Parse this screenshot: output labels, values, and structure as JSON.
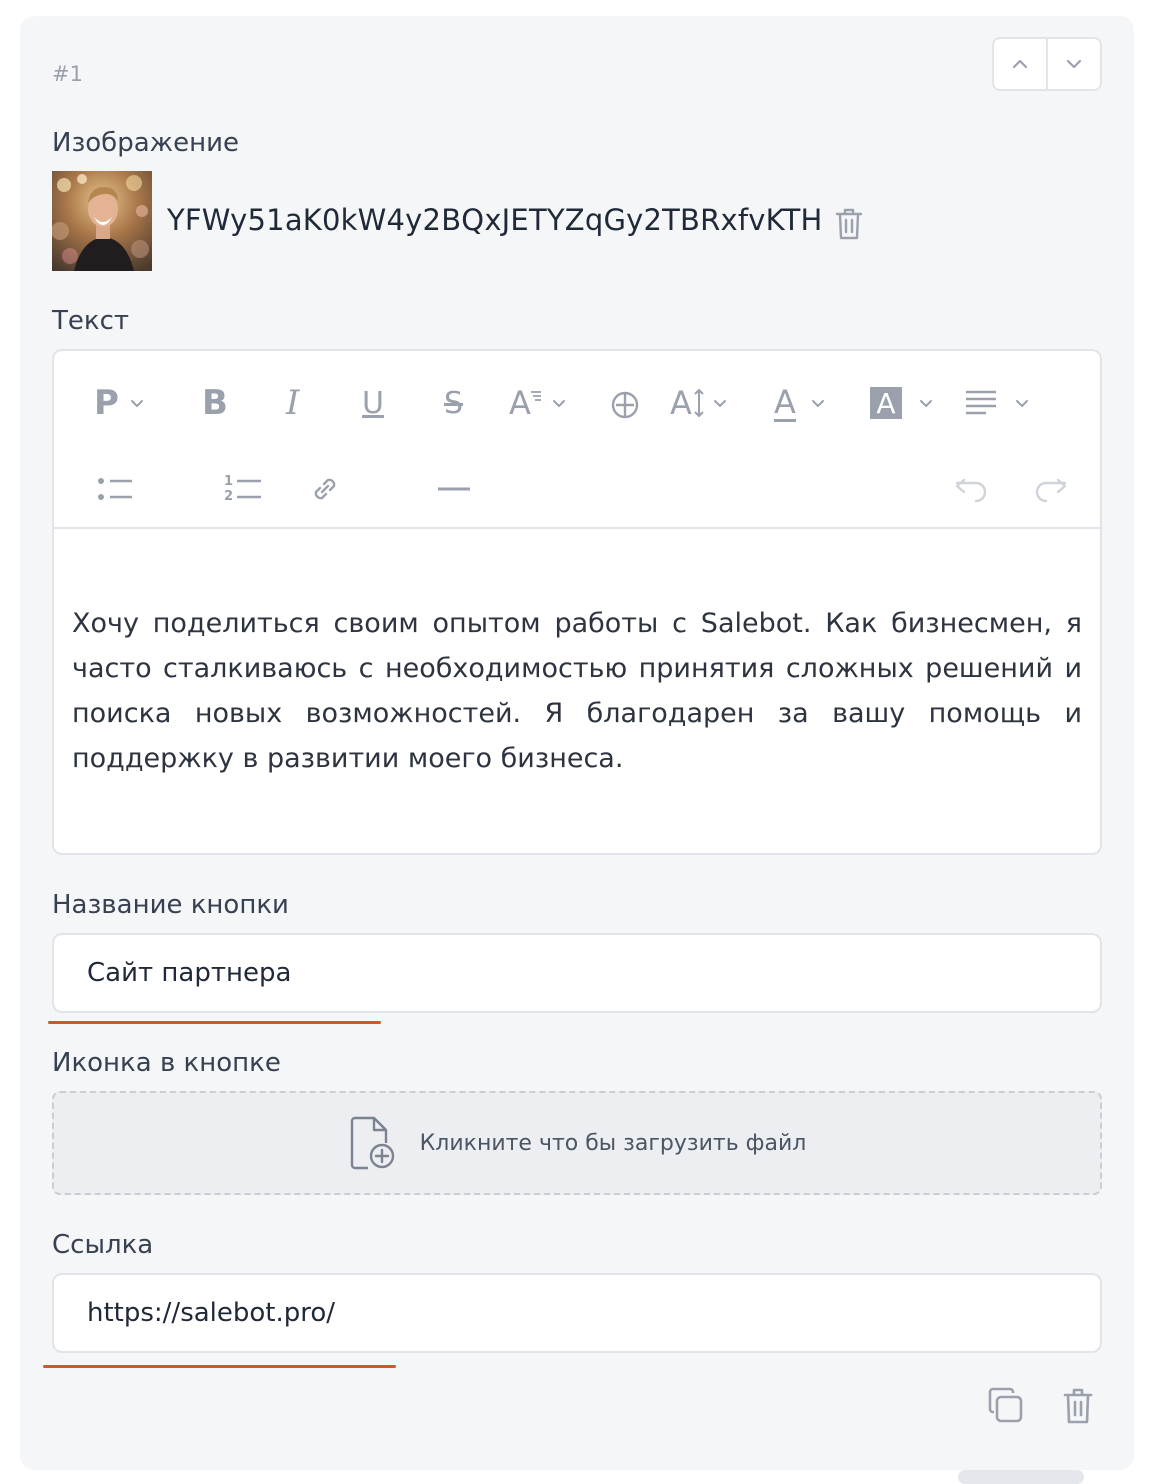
{
  "item": {
    "index": "#1"
  },
  "image": {
    "label": "Изображение",
    "filename": "YFWy51aK0kW4y2BQxJETYZqGy2TBRxfvKTH"
  },
  "text_field": {
    "label": "Текст",
    "content": "Хочу поделиться своим опытом работы с Salebot. Как бизнесмен, я часто сталкиваюсь с необходимостью принятия сложных решений и поиска новых возможностей. Я благодарен за вашу помощь и поддержку в развитии моего бизнеса."
  },
  "toolbar": {
    "paragraph_label": "P",
    "bold_label": "B",
    "italic_label": "I",
    "underline_label": "U",
    "strike_label": "S",
    "font_size_label": "A",
    "line_height_label": "A",
    "text_color_label": "A",
    "bg_color_label": "A",
    "ordered_label_1": "1",
    "ordered_label_2": "2"
  },
  "button_name": {
    "label": "Название кнопки",
    "value": "Сайт партнера"
  },
  "button_icon": {
    "label": "Иконка в кнопке",
    "upload_text": "Кликните что бы загрузить файл"
  },
  "link": {
    "label": "Ссылка",
    "value": "https://salebot.pro/"
  },
  "colors": {
    "accent_underline": "#d9512e",
    "card_bg": "#f5f6f8",
    "border": "#e1e4e9"
  }
}
